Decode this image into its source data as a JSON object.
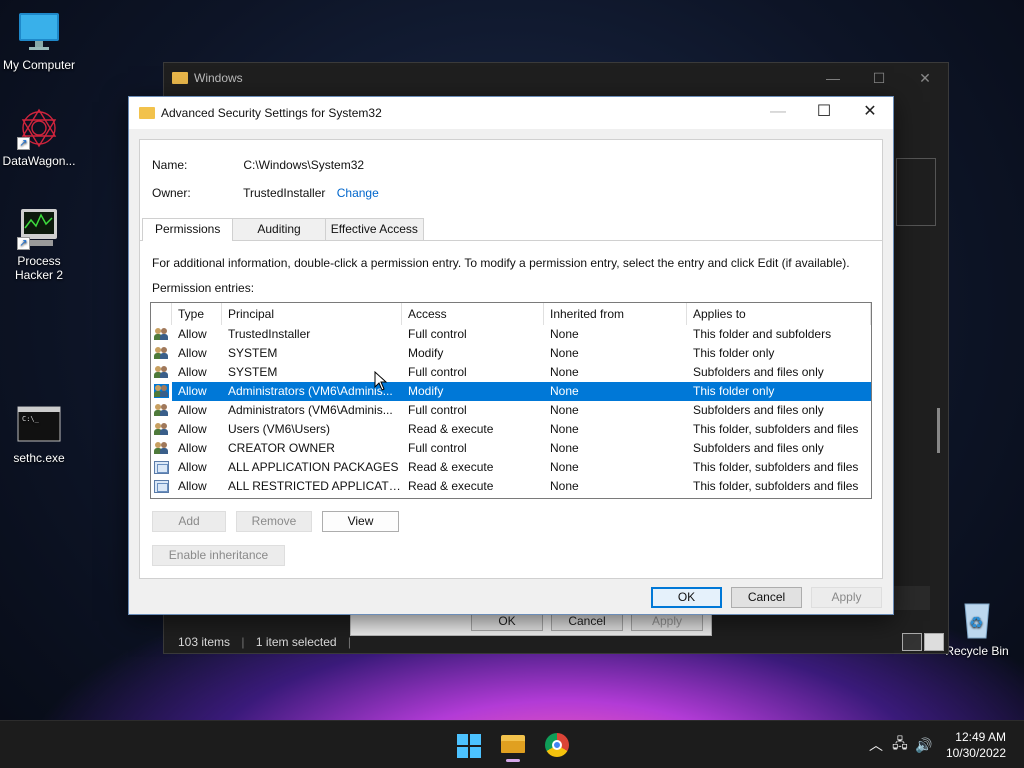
{
  "desktop": {
    "icons": [
      {
        "label": "My Computer"
      },
      {
        "label": "DataWagon..."
      },
      {
        "label": "Process Hacker 2"
      },
      {
        "label": "sethc.exe"
      },
      {
        "label": "Recycle Bin"
      }
    ]
  },
  "bg_window": {
    "title": "Windows",
    "status_items": "103 items",
    "status_selected": "1 item selected",
    "buttons": {
      "ok": "OK",
      "cancel": "Cancel",
      "apply": "Apply"
    }
  },
  "dialog": {
    "title": "Advanced Security Settings for System32",
    "name_label": "Name:",
    "name_value": "C:\\Windows\\System32",
    "owner_label": "Owner:",
    "owner_value": "TrustedInstaller",
    "change_link": "Change",
    "tabs": [
      {
        "label": "Permissions",
        "active": true
      },
      {
        "label": "Auditing",
        "active": false
      },
      {
        "label": "Effective Access",
        "active": false
      }
    ],
    "info_text": "For additional information, double-click a permission entry. To modify a permission entry, select the entry and click Edit (if available).",
    "entries_label": "Permission entries:",
    "columns": {
      "type": "Type",
      "principal": "Principal",
      "access": "Access",
      "inherited": "Inherited from",
      "applies": "Applies to"
    },
    "rows": [
      {
        "icon": "users-icon",
        "type": "Allow",
        "principal": "TrustedInstaller",
        "access": "Full control",
        "inherited": "None",
        "applies": "This folder and subfolders",
        "selected": false
      },
      {
        "icon": "users-icon",
        "type": "Allow",
        "principal": "SYSTEM",
        "access": "Modify",
        "inherited": "None",
        "applies": "This folder only",
        "selected": false
      },
      {
        "icon": "users-icon",
        "type": "Allow",
        "principal": "SYSTEM",
        "access": "Full control",
        "inherited": "None",
        "applies": "Subfolders and files only",
        "selected": false
      },
      {
        "icon": "users-icon",
        "type": "Allow",
        "principal": "Administrators (VM6\\Adminis...",
        "access": "Modify",
        "inherited": "None",
        "applies": "This folder only",
        "selected": true
      },
      {
        "icon": "users-icon",
        "type": "Allow",
        "principal": "Administrators (VM6\\Adminis...",
        "access": "Full control",
        "inherited": "None",
        "applies": "Subfolders and files only",
        "selected": false
      },
      {
        "icon": "users-icon",
        "type": "Allow",
        "principal": "Users (VM6\\Users)",
        "access": "Read & execute",
        "inherited": "None",
        "applies": "This folder, subfolders and files",
        "selected": false
      },
      {
        "icon": "users-icon",
        "type": "Allow",
        "principal": "CREATOR OWNER",
        "access": "Full control",
        "inherited": "None",
        "applies": "Subfolders and files only",
        "selected": false
      },
      {
        "icon": "package-icon",
        "type": "Allow",
        "principal": "ALL APPLICATION PACKAGES",
        "access": "Read & execute",
        "inherited": "None",
        "applies": "This folder, subfolders and files",
        "selected": false
      },
      {
        "icon": "package-icon",
        "type": "Allow",
        "principal": "ALL RESTRICTED APPLICATIO...",
        "access": "Read & execute",
        "inherited": "None",
        "applies": "This folder, subfolders and files",
        "selected": false
      }
    ],
    "buttons": {
      "add": "Add",
      "remove": "Remove",
      "view": "View",
      "enable_inheritance": "Enable inheritance",
      "ok": "OK",
      "cancel": "Cancel",
      "apply": "Apply"
    }
  },
  "taskbar": {
    "time": "12:49 AM",
    "date": "10/30/2022"
  },
  "colors": {
    "selection": "#0078d7",
    "link": "#0066cc"
  }
}
